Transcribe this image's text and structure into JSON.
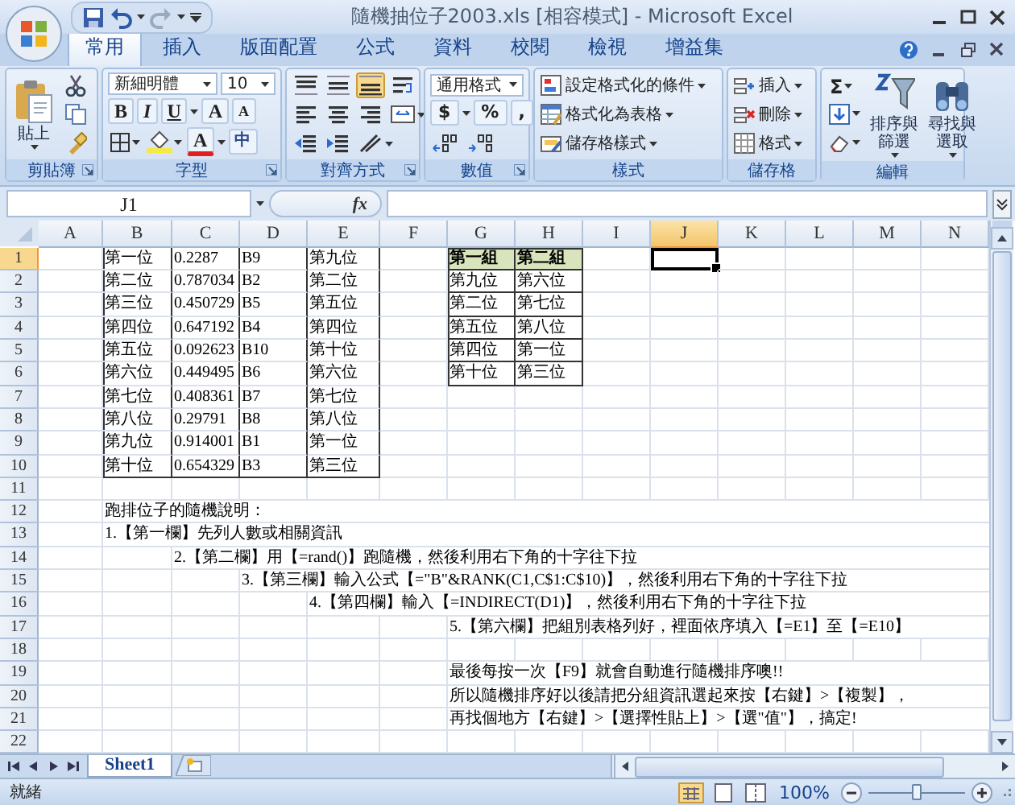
{
  "window": {
    "title": "隨機抽位子2003.xls [相容模式] - Microsoft Excel"
  },
  "tabs": [
    {
      "label": "常用",
      "selected": true
    },
    {
      "label": "插入",
      "selected": false
    },
    {
      "label": "版面配置",
      "selected": false
    },
    {
      "label": "公式",
      "selected": false
    },
    {
      "label": "資料",
      "selected": false
    },
    {
      "label": "校閱",
      "selected": false
    },
    {
      "label": "檢視",
      "selected": false
    },
    {
      "label": "增益集",
      "selected": false
    }
  ],
  "ribbon": {
    "groups": [
      {
        "kind": "clipboard",
        "label": "剪貼簿",
        "launcher": true,
        "paste": "貼上"
      },
      {
        "kind": "font",
        "label": "字型",
        "launcher": true,
        "font": "新細明體",
        "size": "10",
        "styles": [
          "B",
          "I",
          "U"
        ],
        "grow": "A",
        "shrink": "A",
        "color_letter": "A",
        "phonetic": "中"
      },
      {
        "kind": "alignment",
        "label": "對齊方式",
        "launcher": true
      },
      {
        "kind": "number",
        "label": "數值",
        "launcher": true,
        "format": "通用格式",
        "buttons": [
          "$",
          "%",
          ","
        ]
      },
      {
        "kind": "commands",
        "label": "樣式",
        "launcher": false,
        "commands": [
          "設定格式化的條件",
          "格式化為表格",
          "儲存格樣式"
        ]
      },
      {
        "kind": "commands",
        "label": "儲存格",
        "launcher": false,
        "commands": [
          "插入",
          "刪除",
          "格式"
        ]
      },
      {
        "kind": "editing",
        "label": "編輯",
        "launcher": false,
        "sum": "Σ",
        "big": [
          "排序與篩選",
          "尋找與選取"
        ]
      }
    ]
  },
  "formula_bar": {
    "name_box": "J1",
    "insert_function": "fx"
  },
  "sheet": {
    "columns": [
      {
        "label": "A",
        "selected": false
      },
      {
        "label": "B",
        "selected": false
      },
      {
        "label": "C",
        "selected": false
      },
      {
        "label": "D",
        "selected": false
      },
      {
        "label": "E",
        "selected": false
      },
      {
        "label": "F",
        "selected": false
      },
      {
        "label": "G",
        "selected": false
      },
      {
        "label": "H",
        "selected": false
      },
      {
        "label": "I",
        "selected": false
      },
      {
        "label": "J",
        "selected": true
      },
      {
        "label": "K",
        "selected": false
      },
      {
        "label": "L",
        "selected": false
      },
      {
        "label": "M",
        "selected": false
      },
      {
        "label": "N",
        "selected": false
      }
    ],
    "rows": [
      {
        "label": "1",
        "selected": true,
        "cells": [
          "",
          {
            "text": "第一位",
            "kind": "table"
          },
          {
            "text": "0.2287",
            "kind": "table"
          },
          {
            "text": "B9",
            "kind": "table"
          },
          {
            "text": "第九位",
            "kind": "table"
          },
          "",
          {
            "text": "第一組",
            "kind": "group-head"
          },
          {
            "text": "第二組",
            "kind": "group-head"
          }
        ]
      },
      {
        "label": "2",
        "selected": false,
        "cells": [
          "",
          {
            "text": "第二位",
            "kind": "table"
          },
          {
            "text": "0.787034",
            "kind": "table"
          },
          {
            "text": "B2",
            "kind": "table"
          },
          {
            "text": "第二位",
            "kind": "table"
          },
          "",
          {
            "text": "第九位",
            "kind": "group"
          },
          {
            "text": "第六位",
            "kind": "group"
          }
        ]
      },
      {
        "label": "3",
        "selected": false,
        "cells": [
          "",
          {
            "text": "第三位",
            "kind": "table"
          },
          {
            "text": "0.450729",
            "kind": "table"
          },
          {
            "text": "B5",
            "kind": "table"
          },
          {
            "text": "第五位",
            "kind": "table"
          },
          "",
          {
            "text": "第二位",
            "kind": "group"
          },
          {
            "text": "第七位",
            "kind": "group"
          }
        ]
      },
      {
        "label": "4",
        "selected": false,
        "cells": [
          "",
          {
            "text": "第四位",
            "kind": "table"
          },
          {
            "text": "0.647192",
            "kind": "table"
          },
          {
            "text": "B4",
            "kind": "table"
          },
          {
            "text": "第四位",
            "kind": "table"
          },
          "",
          {
            "text": "第五位",
            "kind": "group"
          },
          {
            "text": "第八位",
            "kind": "group"
          }
        ]
      },
      {
        "label": "5",
        "selected": false,
        "cells": [
          "",
          {
            "text": "第五位",
            "kind": "table"
          },
          {
            "text": "0.092623",
            "kind": "table"
          },
          {
            "text": "B10",
            "kind": "table"
          },
          {
            "text": "第十位",
            "kind": "table"
          },
          "",
          {
            "text": "第四位",
            "kind": "group"
          },
          {
            "text": "第一位",
            "kind": "group"
          }
        ]
      },
      {
        "label": "6",
        "selected": false,
        "cells": [
          "",
          {
            "text": "第六位",
            "kind": "table"
          },
          {
            "text": "0.449495",
            "kind": "table"
          },
          {
            "text": "B6",
            "kind": "table"
          },
          {
            "text": "第六位",
            "kind": "table"
          },
          "",
          {
            "text": "第十位",
            "kind": "group"
          },
          {
            "text": "第三位",
            "kind": "group"
          }
        ]
      },
      {
        "label": "7",
        "selected": false,
        "cells": [
          "",
          {
            "text": "第七位",
            "kind": "table"
          },
          {
            "text": "0.408361",
            "kind": "table"
          },
          {
            "text": "B7",
            "kind": "table"
          },
          {
            "text": "第七位",
            "kind": "table"
          }
        ]
      },
      {
        "label": "8",
        "selected": false,
        "cells": [
          "",
          {
            "text": "第八位",
            "kind": "table"
          },
          {
            "text": "0.29791",
            "kind": "table"
          },
          {
            "text": "B8",
            "kind": "table"
          },
          {
            "text": "第八位",
            "kind": "table"
          }
        ]
      },
      {
        "label": "9",
        "selected": false,
        "cells": [
          "",
          {
            "text": "第九位",
            "kind": "table"
          },
          {
            "text": "0.914001",
            "kind": "table"
          },
          {
            "text": "B1",
            "kind": "table"
          },
          {
            "text": "第一位",
            "kind": "table"
          }
        ]
      },
      {
        "label": "10",
        "selected": false,
        "cells": [
          "",
          {
            "text": "第十位",
            "kind": "table"
          },
          {
            "text": "0.654329",
            "kind": "table"
          },
          {
            "text": "B3",
            "kind": "table"
          },
          {
            "text": "第三位",
            "kind": "table"
          }
        ]
      },
      {
        "label": "11",
        "selected": false,
        "cells": []
      },
      {
        "label": "12",
        "selected": false,
        "cells": [
          "",
          {
            "text": "跑排位子的隨機說明：",
            "kind": "note"
          }
        ]
      },
      {
        "label": "13",
        "selected": false,
        "cells": [
          "",
          {
            "text": "1.【第一欄】先列人數或相關資訊",
            "kind": "note"
          }
        ]
      },
      {
        "label": "14",
        "selected": false,
        "cells": [
          "",
          "",
          {
            "text": "2.【第二欄】用【=rand()】跑隨機，然後利用右下角的十字往下拉",
            "kind": "note"
          }
        ]
      },
      {
        "label": "15",
        "selected": false,
        "cells": [
          "",
          "",
          "",
          {
            "text": "3.【第三欄】輸入公式【=\"B\"&RANK(C1,C$1:C$10)】，然後利用右下角的十字往下拉",
            "kind": "note"
          }
        ]
      },
      {
        "label": "16",
        "selected": false,
        "cells": [
          "",
          "",
          "",
          "",
          {
            "text": "4.【第四欄】輸入【=INDIRECT(D1)】，然後利用右下角的十字往下拉",
            "kind": "note"
          }
        ]
      },
      {
        "label": "17",
        "selected": false,
        "cells": [
          "",
          "",
          "",
          "",
          "",
          "",
          {
            "text": "5.【第六欄】把組別表格列好，裡面依序填入【=E1】至【=E10】",
            "kind": "note"
          }
        ]
      },
      {
        "label": "18",
        "selected": false,
        "cells": []
      },
      {
        "label": "19",
        "selected": false,
        "cells": [
          "",
          "",
          "",
          "",
          "",
          "",
          {
            "text": "最後每按一次【F9】就會自動進行隨機排序噢!!",
            "kind": "note"
          }
        ]
      },
      {
        "label": "20",
        "selected": false,
        "cells": [
          "",
          "",
          "",
          "",
          "",
          "",
          {
            "text": "所以隨機排序好以後請把分組資訊選起來按【右鍵】>【複製】，",
            "kind": "note"
          }
        ]
      },
      {
        "label": "21",
        "selected": false,
        "cells": [
          "",
          "",
          "",
          "",
          "",
          "",
          {
            "text": "再找個地方【右鍵】>【選擇性貼上】>【選\"值\"】，搞定!",
            "kind": "note"
          }
        ]
      },
      {
        "label": "22",
        "selected": false,
        "cells": []
      }
    ]
  },
  "sheet_tabs": [
    {
      "label": "Sheet1",
      "selected": true
    }
  ],
  "status_bar": {
    "status": "就緒",
    "zoom": {
      "label": "100%",
      "level": 0.5
    }
  }
}
